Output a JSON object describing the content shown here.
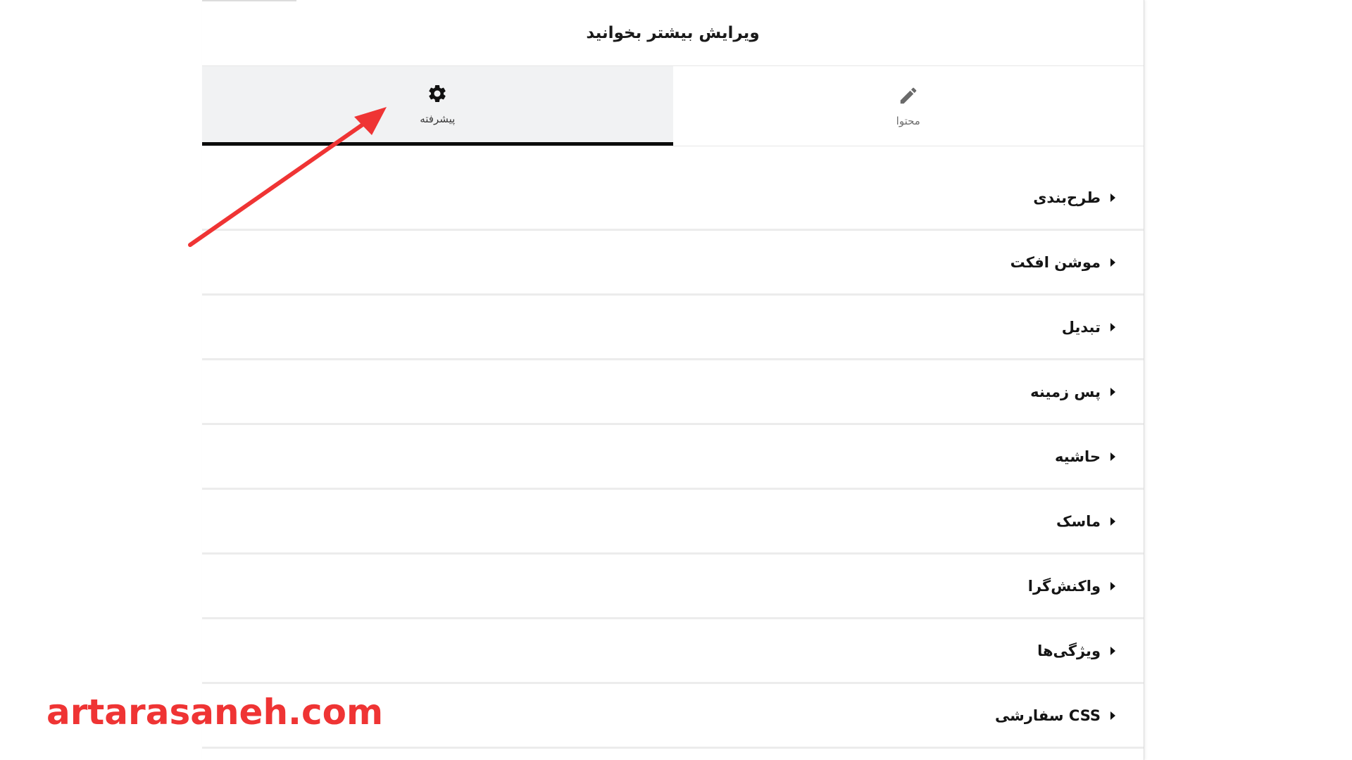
{
  "panel": {
    "title": "ویرایش بیشتر بخوانید"
  },
  "tabs": [
    {
      "label": "محتوا",
      "icon": "pencil-icon",
      "active": false
    },
    {
      "label": "پیشرفته",
      "icon": "gear-icon",
      "active": true
    }
  ],
  "sections": [
    {
      "label": "طرح‌بندی"
    },
    {
      "label": "موشن افکت"
    },
    {
      "label": "تبدیل"
    },
    {
      "label": "پس زمینه"
    },
    {
      "label": "حاشیه"
    },
    {
      "label": "ماسک"
    },
    {
      "label": "واکنش‌گرا"
    },
    {
      "label": "ویژگی‌ها"
    },
    {
      "label": "CSS سفارشی"
    }
  ],
  "watermark": {
    "text": "artarasaneh.com"
  },
  "colors": {
    "annotation_arrow": "#ef3434",
    "active_tab_bg": "#f1f2f3",
    "active_tab_border": "#0b0b0b"
  }
}
